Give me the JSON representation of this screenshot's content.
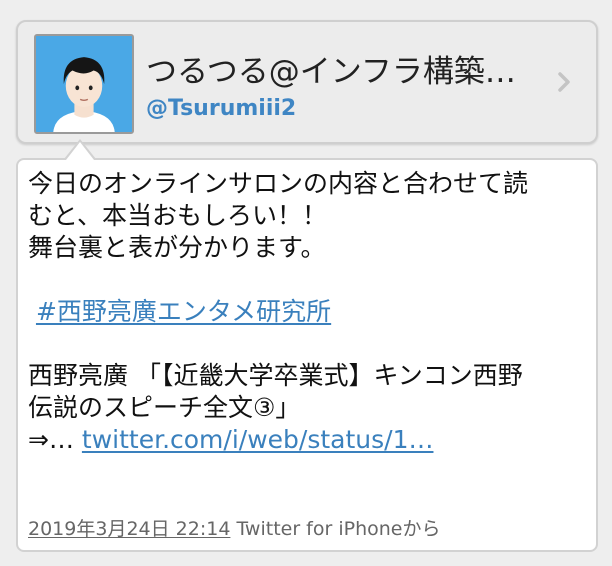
{
  "user": {
    "display_name": "つるつる@インフラ構築…",
    "screen_name": "@Tsurumiii2",
    "avatar_icon": "user-avatar-icon"
  },
  "tweet": {
    "line1": "今日のオンラインサロンの内容と合わせて読",
    "line2": "むと、本当おもしろい！！",
    "line3": "舞台裏と表が分かります。",
    "hashtag": "#西野亮廣エンタメ研究所",
    "line5": "西野亮廣 「【近畿大学卒業式】キンコン西野",
    "line6": "伝説のスピーチ全文③」",
    "link_prefix": " ⇒… ",
    "link": "twitter.com/i/web/status/1…"
  },
  "meta": {
    "timestamp": "2019年3月24日 22:14",
    "source": " Twitter for iPhoneから"
  },
  "colors": {
    "link": "#3a80bd",
    "screen_name": "#3f86c4",
    "avatar_bg": "#4aa8e6"
  }
}
